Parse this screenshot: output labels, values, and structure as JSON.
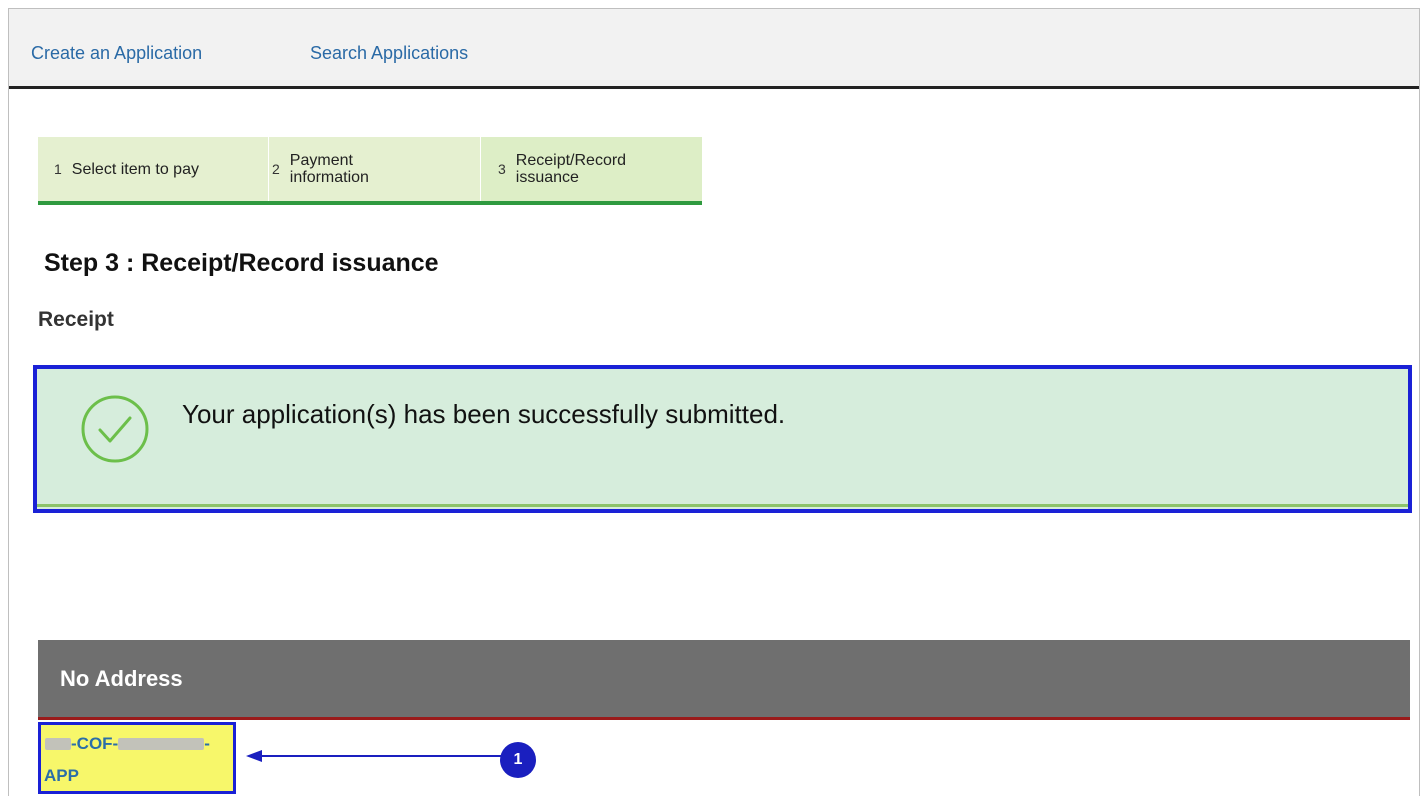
{
  "nav": {
    "create_label": "Create an Application",
    "search_label": "Search Applications"
  },
  "steps": [
    {
      "number": "1",
      "label": "Select item to pay"
    },
    {
      "number": "2",
      "label_line1": "Payment",
      "label_line2": "information"
    },
    {
      "number": "3",
      "label_line1": "Receipt/Record",
      "label_line2": "issuance"
    }
  ],
  "page": {
    "heading": "Step 3 : Receipt/Record issuance",
    "section_label": "Receipt"
  },
  "notice": {
    "icon": "check-circle-icon",
    "message": "Your application(s) has been successfully submitted."
  },
  "address": {
    "title": "No Address"
  },
  "record": {
    "id_middle": "-COF-",
    "id_suffix": "-",
    "id_line2": "APP"
  },
  "callout": {
    "number": "1"
  },
  "colors": {
    "link": "#2a6aa6",
    "step_bg": "#e5f0d0",
    "step_active_bar": "#2f9a3f",
    "success_bg": "#d6eddc",
    "highlight_border": "#1a21d6",
    "address_bar": "#6f6f6f",
    "record_highlight": "#f7f76a"
  }
}
